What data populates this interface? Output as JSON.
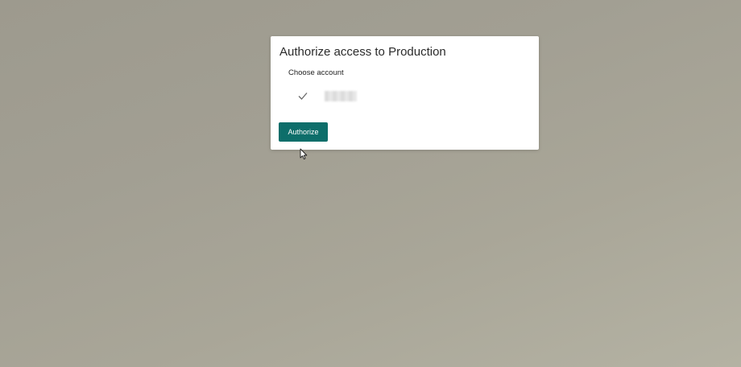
{
  "dialog": {
    "title": "Authorize access to Production",
    "section_label": "Choose account",
    "account": {
      "name": "",
      "selected": true,
      "icon": "check-icon"
    },
    "authorize_label": "Authorize"
  },
  "colors": {
    "primary_button": "#0d6e6a",
    "background": "#a29f93"
  }
}
